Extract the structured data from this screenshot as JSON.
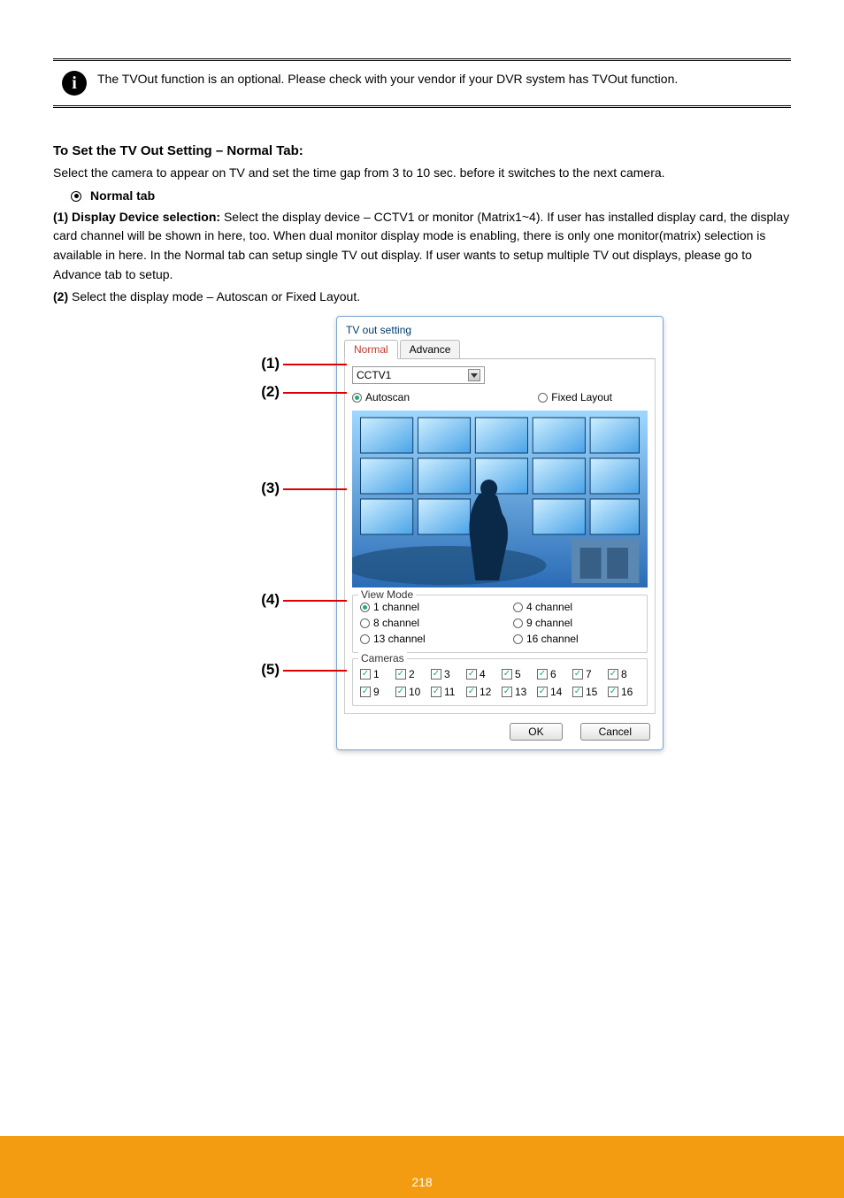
{
  "info_note": "The TVOut function is an optional. Please check with your vendor if your DVR system has TVOut function.",
  "section_title": "To Set the TV Out Setting – Normal Tab:",
  "intro": "Select the camera to appear on TV and set the time gap from 3 to 10 sec. before it switches to the next camera.",
  "bullet_label": "Normal tab",
  "item1_label": "(1) Display Device selection:",
  "item1_text": " Select the display device – CCTV1 or monitor (Matrix1~4). If user has installed display card, the display card channel will be shown in here, too. When dual monitor display mode is enabling, there is only one monitor(matrix) selection is available in here. In the Normal tab can setup single TV out display. If user wants to setup multiple TV out displays, please go to Advance tab to setup.",
  "item2_label": "(2)",
  "item2_text": " Select the display mode – Autoscan or Fixed Layout.",
  "dialog": {
    "title": "TV out setting",
    "tabs": {
      "normal": "Normal",
      "advance": "Advance"
    },
    "dropdown": "CCTV1",
    "radio_autoscan": "Autoscan",
    "radio_fixed": "Fixed Layout",
    "view_mode_legend": "View Mode",
    "vm": [
      "1 channel",
      "4 channel",
      "8 channel",
      "9 channel",
      "13 channel",
      "16 channel"
    ],
    "cameras_legend": "Cameras",
    "cams": [
      "1",
      "2",
      "3",
      "4",
      "5",
      "6",
      "7",
      "8",
      "9",
      "10",
      "11",
      "12",
      "13",
      "14",
      "15",
      "16"
    ],
    "ok": "OK",
    "cancel": "Cancel"
  },
  "callouts": [
    "(1)",
    "(2)",
    "(3)",
    "(4)",
    "(5)"
  ],
  "page_number": "218"
}
